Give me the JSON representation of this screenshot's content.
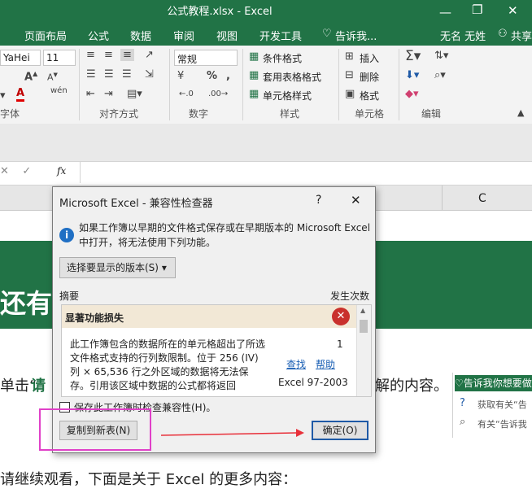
{
  "window": {
    "title": "公式教程.xlsx - Excel"
  },
  "tabs": [
    "页面布局",
    "公式",
    "数据",
    "审阅",
    "视图",
    "开发工具"
  ],
  "tell_me": "告诉我...",
  "user": "无名 无姓",
  "share": "共享",
  "ribbon": {
    "font": {
      "name": "YaHei",
      "size": "11",
      "group_label": "字体"
    },
    "alignment": {
      "group_label": "对齐方式"
    },
    "number": {
      "format": "常规",
      "currency": "¥",
      "percent": "%",
      "comma": ",",
      "group_label": "数字"
    },
    "styles": {
      "conditional": "条件格式",
      "table": "套用表格格式",
      "cell": "单元格样式",
      "group_label": "样式"
    },
    "cells": {
      "insert": "插入",
      "delete": "删除",
      "format": "格式",
      "group_label": "单元格"
    },
    "editing": {
      "group_label": "编辑"
    }
  },
  "formula_bar": {
    "fx": "fx"
  },
  "column_header": "C",
  "background_texts": {
    "heading_fragment": "还有",
    "line1_start": "单击“",
    "line1_bold": "请",
    "line1_end": "解的内容。",
    "bottom_line": "请继续观看，下面是关于 Excel 的更多内容："
  },
  "tellme_pane": {
    "header": "告诉我你想要做",
    "item1": "获取有关“告",
    "item2": "有关“告诉我"
  },
  "dialog": {
    "title": "Microsoft Excel - 兼容性检查器",
    "help": "?",
    "close": "✕",
    "info_text": "如果工作簿以早期的文件格式保存或在早期版本的 Microsoft Excel 中打开，将无法使用下列功能。",
    "version_button": "选择要显示的版本(S)",
    "summary_label": "摘要",
    "occurrences_label": "发生次数",
    "issue": {
      "category": "显著功能损失",
      "description": "此工作簿包含的数据所在的单元格超出了所选文件格式支持的行列数限制。位于 256 (IV)列 × 65,536 行之外区域的数据将无法保存。引用该区域中数据的公式都将返回",
      "count": "1",
      "find": "查找",
      "help": "帮助",
      "version": "Excel 97-2003"
    },
    "check_label": "保存此工作簿时检查兼容性(H)。",
    "copy_button": "复制到新表(N)",
    "ok_button": "确定(O)"
  },
  "colors": {
    "excel_green": "#217346",
    "annotation_magenta": "#e040c8",
    "annotation_red": "#e8303a",
    "link_blue": "#1a5fb4"
  }
}
